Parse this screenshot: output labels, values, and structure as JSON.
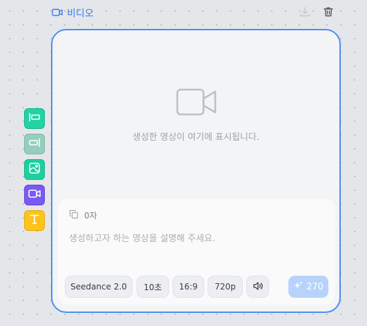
{
  "header": {
    "title": "비디오",
    "icon": "video-camera-icon",
    "accent_color": "#3d7bf0"
  },
  "header_actions": [
    {
      "name": "download",
      "icon": "download-icon"
    },
    {
      "name": "delete",
      "icon": "trash-icon"
    }
  ],
  "side_tools": [
    {
      "icon": "align-left-block-icon",
      "color": "#22d3a4"
    },
    {
      "icon": "align-right-block-icon",
      "color": "#95cfbc"
    },
    {
      "icon": "image-icon",
      "color": "#1dd0a0"
    },
    {
      "icon": "video-icon",
      "color": "#7b5af2"
    },
    {
      "icon": "text-icon",
      "color": "#ffc419"
    }
  ],
  "preview": {
    "icon": "video-camera-icon",
    "empty_text": "생성한 영상이 여기에 표시됩니다."
  },
  "prompt": {
    "char_count": "0자",
    "copy_icon": "copy-icon",
    "placeholder": "생성하고자 하는 영상을 설명해 주세요.",
    "value": ""
  },
  "options": {
    "model": "Seedance 2.0",
    "duration": "10초",
    "ratio": "16:9",
    "resolution": "720p",
    "audio_icon": "speaker-icon"
  },
  "generate": {
    "icon": "sparkle-icon",
    "credits": "270",
    "color": "#b7d3fb"
  },
  "colors": {
    "card_border": "#4a8cf2",
    "canvas_background": "#e4e6ea"
  }
}
